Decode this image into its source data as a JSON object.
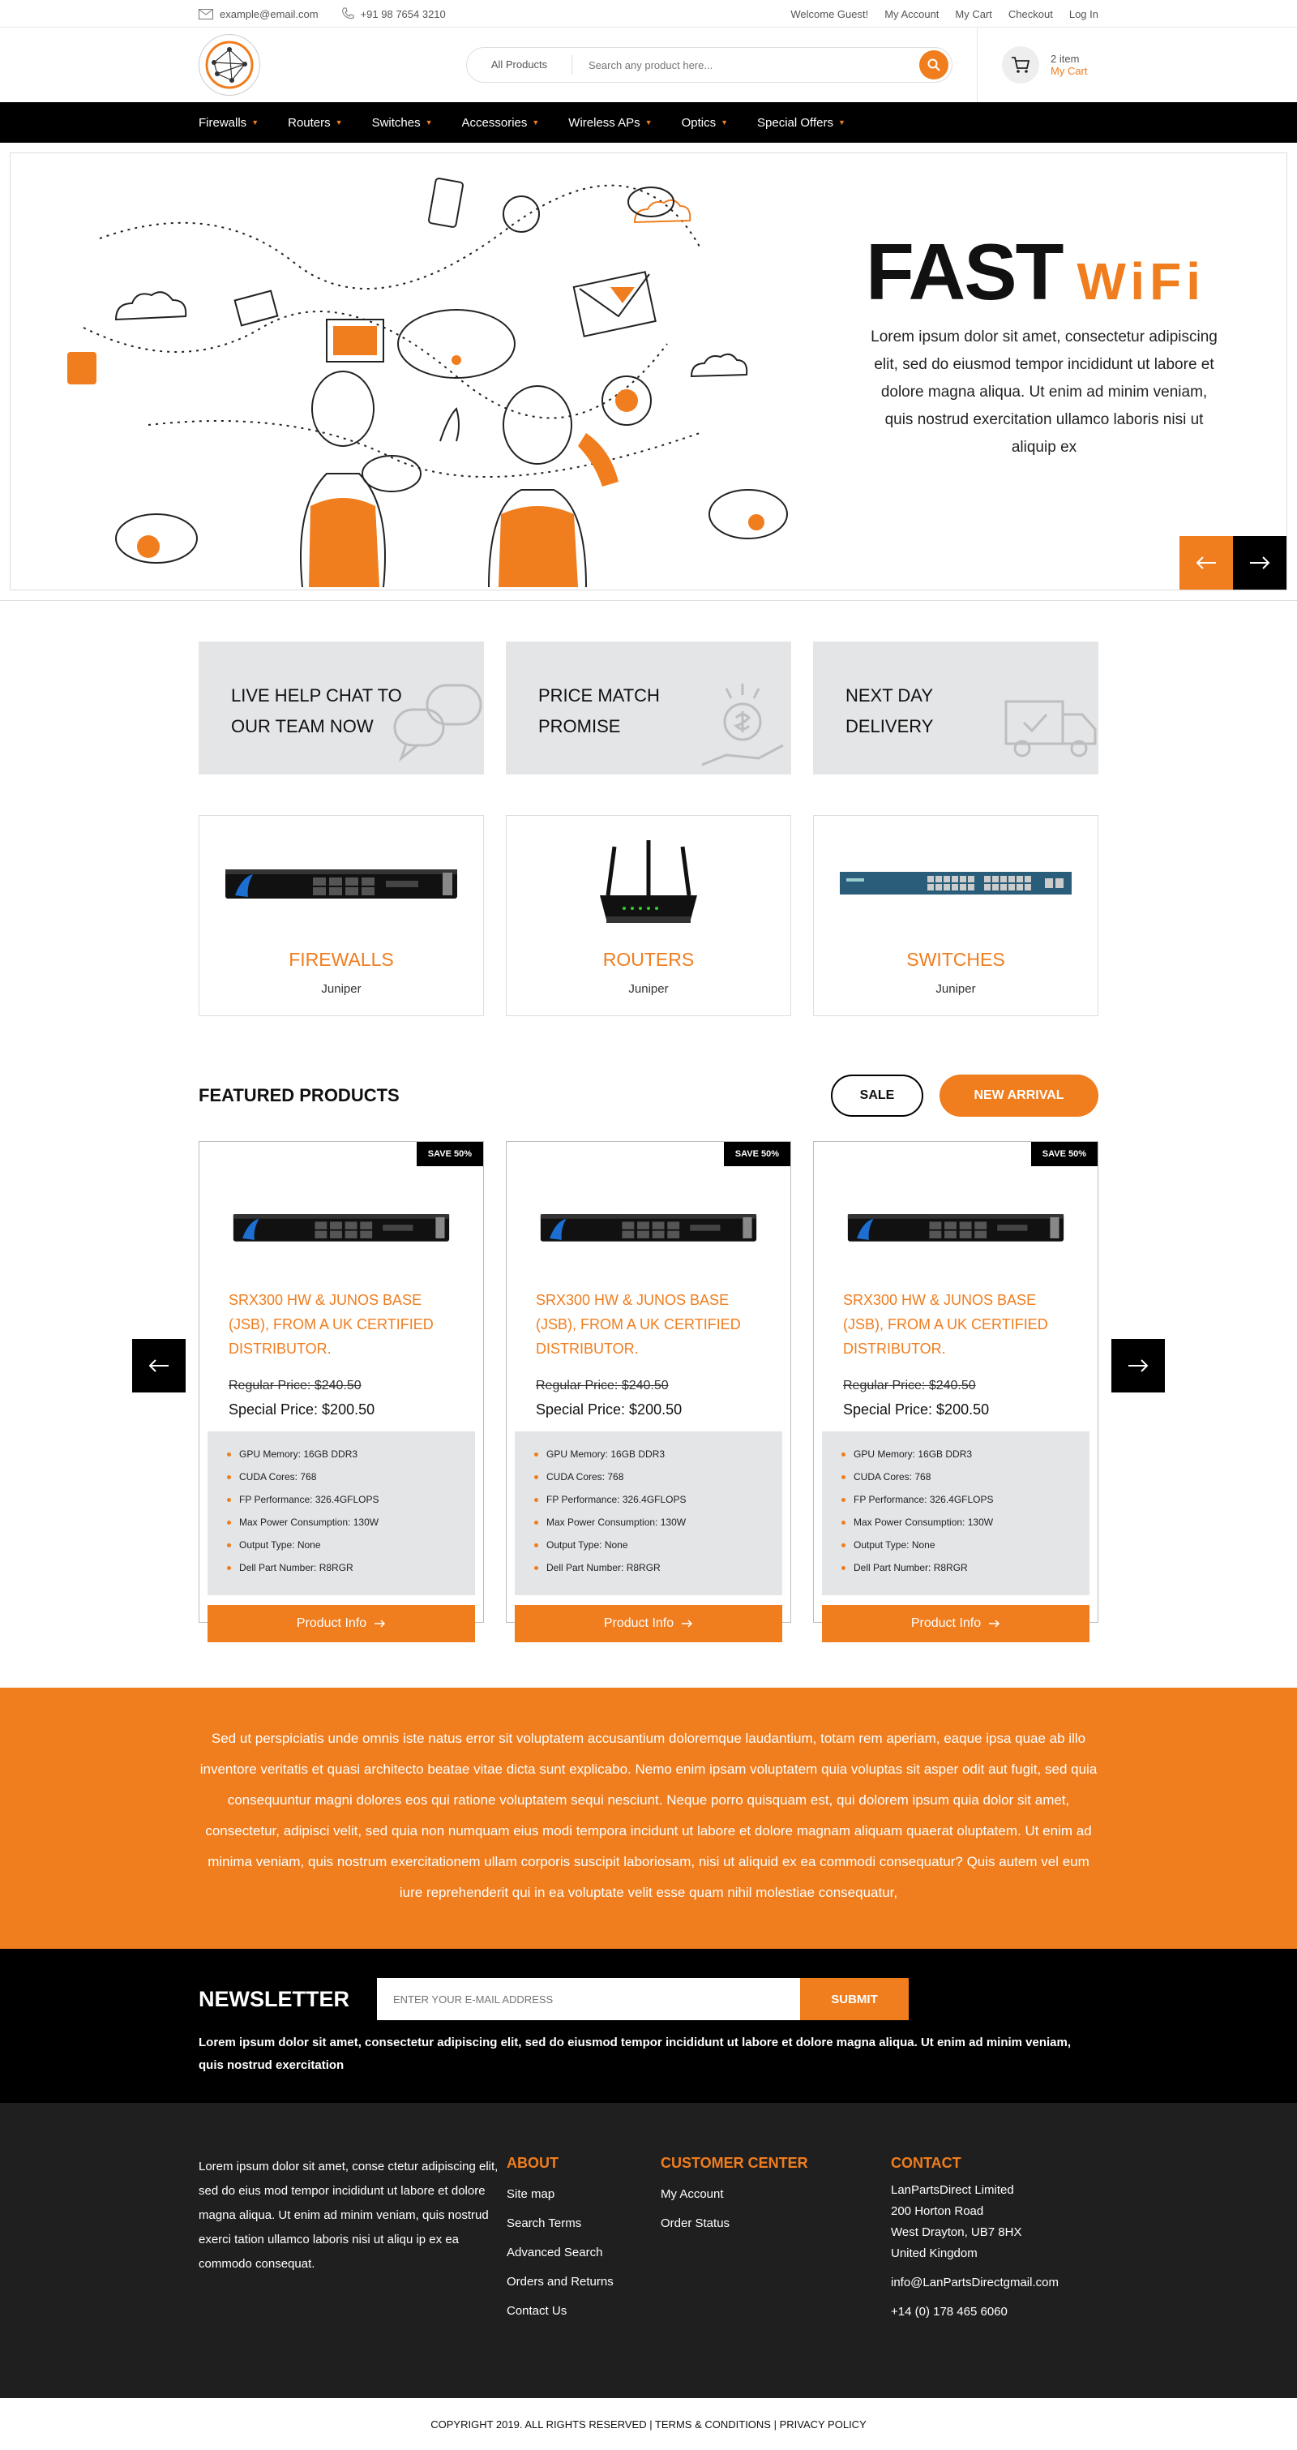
{
  "topbar": {
    "email": "example@email.com",
    "phone": "+91 98 7654 3210",
    "links": [
      "Welcome Guest!",
      "My Account",
      "My Cart",
      "Checkout",
      "Log In"
    ]
  },
  "header": {
    "search_category": "All Products",
    "search_placeholder": "Search any product here...",
    "cart_items": "2 item",
    "cart_label": "My Cart"
  },
  "nav": {
    "items": [
      "Firewalls",
      "Routers",
      "Switches",
      "Accessories",
      "Wireless APs",
      "Optics",
      "Special Offers"
    ]
  },
  "hero": {
    "title_main": "FAST",
    "title_accent": "WiFi",
    "description": "Lorem ipsum dolor sit amet, consectetur adipiscing elit, sed do eiusmod tempor incididunt ut labore et dolore magna aliqua. Ut enim ad minim veniam, quis nostrud exercitation ullamco laboris nisi ut aliquip ex"
  },
  "features": [
    {
      "line1": "LIVE HELP CHAT TO",
      "line2": "OUR TEAM NOW"
    },
    {
      "line1": "PRICE MATCH",
      "line2": "PROMISE"
    },
    {
      "line1": "NEXT DAY",
      "line2": "DELIVERY"
    }
  ],
  "categories": [
    {
      "name": "FIREWALLS",
      "brand": "Juniper"
    },
    {
      "name": "ROUTERS",
      "brand": "Juniper"
    },
    {
      "name": "SWITCHES",
      "brand": "Juniper"
    }
  ],
  "featured": {
    "heading": "FEATURED PRODUCTS",
    "sale_label": "SALE",
    "new_label": "NEW ARRIVAL",
    "products": [
      {
        "badge": "SAVE 50%",
        "title": "SRX300 HW & JUNOS BASE (JSB), FROM A UK CERTIFIED DISTRIBUTOR.",
        "regular": "Regular Price: $240.50",
        "special": "Special Price: $200.50",
        "specs": [
          "GPU Memory: 16GB DDR3",
          "CUDA Cores: 768",
          "FP Performance: 326.4GFLOPS",
          "Max Power Consumption: 130W",
          "Output Type: None",
          "Dell Part Number: R8RGR"
        ],
        "button": "Product Info"
      },
      {
        "badge": "SAVE 50%",
        "title": "SRX300 HW & JUNOS BASE (JSB), FROM A UK CERTIFIED DISTRIBUTOR.",
        "regular": "Regular Price: $240.50",
        "special": "Special Price: $200.50",
        "specs": [
          "GPU Memory: 16GB DDR3",
          "CUDA Cores: 768",
          "FP Performance: 326.4GFLOPS",
          "Max Power Consumption: 130W",
          "Output Type: None",
          "Dell Part Number: R8RGR"
        ],
        "button": "Product Info"
      },
      {
        "badge": "SAVE 50%",
        "title": "SRX300 HW & JUNOS BASE (JSB), FROM A UK CERTIFIED DISTRIBUTOR.",
        "regular": "Regular Price: $240.50",
        "special": "Special Price: $200.50",
        "specs": [
          "GPU Memory: 16GB DDR3",
          "CUDA Cores: 768",
          "FP Performance: 326.4GFLOPS",
          "Max Power Consumption: 130W",
          "Output Type: None",
          "Dell Part Number: R8RGR"
        ],
        "button": "Product Info"
      }
    ]
  },
  "band": {
    "text": "Sed ut perspiciatis unde omnis iste natus error sit voluptatem accusantium doloremque laudantium, totam rem aperiam, eaque ipsa quae ab illo inventore veritatis et quasi architecto beatae vitae dicta sunt explicabo. Nemo enim ipsam voluptatem quia voluptas sit asper odit aut fugit, sed quia consequuntur magni dolores eos qui ratione voluptatem sequi nesciunt. Neque porro quisquam est, qui dolorem ipsum quia dolor sit amet, consectetur, adipisci velit, sed quia non numquam eius modi tempora incidunt ut labore et dolore magnam aliquam quaerat oluptatem. Ut enim ad minima veniam, quis nostrum exercitationem ullam corporis suscipit laboriosam, nisi ut aliquid ex ea commodi consequatur? Quis autem vel eum iure reprehenderit qui in ea voluptate velit esse quam nihil molestiae consequatur,"
  },
  "newsletter": {
    "heading": "NEWSLETTER",
    "placeholder": "ENTER YOUR E-MAIL ADDRESS",
    "submit": "SUBMIT",
    "text": "Lorem ipsum dolor sit amet, consectetur adipiscing elit, sed do eiusmod tempor incididunt ut labore et dolore magna aliqua. Ut enim ad minim veniam, quis nostrud exercitation"
  },
  "footer": {
    "about": "Lorem ipsum dolor sit amet, conse ctetur adipiscing elit, sed do eius mod tempor incididunt ut labore et dolore magna aliqua. Ut enim ad minim veniam, quis nostrud exerci tation ullamco laboris nisi ut aliqu ip ex ea commodo consequat.",
    "about_heading": "ABOUT",
    "about_links": [
      "Site map",
      "Search Terms",
      "Advanced Search",
      "Orders and Returns",
      "Contact Us"
    ],
    "customer_heading": "CUSTOMER CENTER",
    "customer_links": [
      "My Account",
      "Order Status"
    ],
    "contact_heading": "CONTACT",
    "contact_lines": [
      "LanPartsDirect Limited",
      "200 Horton Road",
      "West Drayton, UB7 8HX",
      "United Kingdom"
    ],
    "contact_email": "info@LanPartsDirectgmail.com",
    "contact_phone": "+14 (0) 178 465 6060",
    "copyright": "COPYRIGHT 2019. ALL RIGHTS RESERVED | TERMS & CONDITIONS | PRIVACY POLICY"
  },
  "colors": {
    "accent": "#f07d1e",
    "dark": "#000000",
    "footer": "#1f1f1f",
    "panel": "#e4e5e7"
  }
}
